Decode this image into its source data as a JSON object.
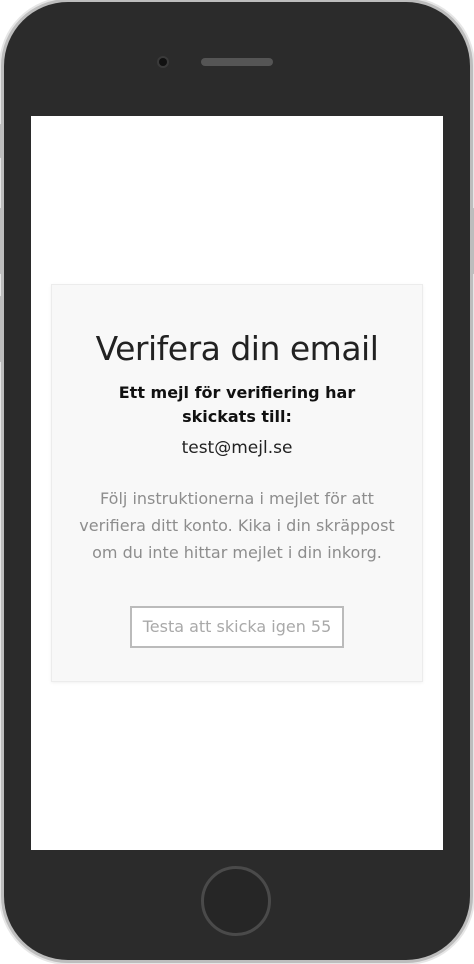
{
  "screen": {
    "title": "Verifera din email",
    "subtitle": "Ett mejl för verifiering har skickats till:",
    "email": "test@mejl.se",
    "description": "Följ instruktionerna i mejlet för att verifiera ditt konto. Kika i din skräppost om du inte hittar mejlet i din inkorg.",
    "resend_button": "Testa att skicka igen 55"
  },
  "colors": {
    "card_background": "#f8f8f8",
    "title_text": "#222222",
    "muted_text": "#8d8d8d",
    "button_border": "#bbbbbb",
    "phone_body": "#2b2b2b"
  },
  "icons": {
    "device": "iphone-frame",
    "home": "home-button-icon"
  }
}
